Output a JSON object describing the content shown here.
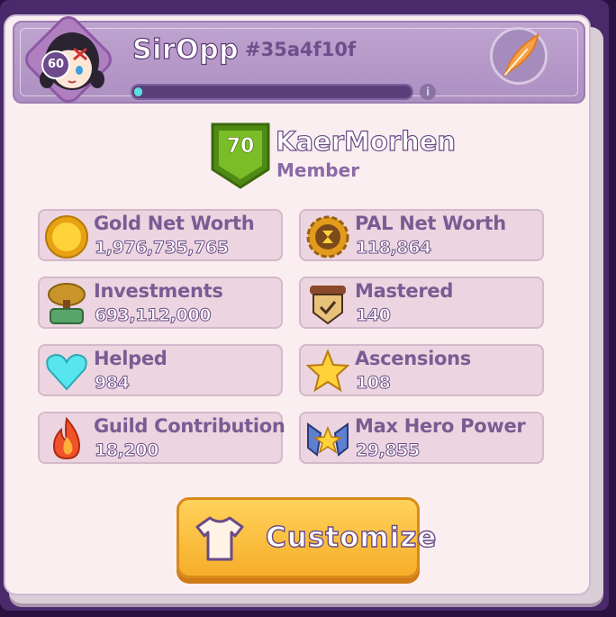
{
  "player": {
    "level": "60",
    "name": "SirOpp",
    "id": "#35a4f10f",
    "xp_progress": 0.03
  },
  "guild": {
    "level": "70",
    "name": "KaerMorhen",
    "role": "Member"
  },
  "stats": [
    {
      "label": "Gold Net Worth",
      "value": "1,976,735,765",
      "icon": "gold-coin-icon"
    },
    {
      "label": "PAL Net Worth",
      "value": "118,864",
      "icon": "pal-gear-icon"
    },
    {
      "label": "Investments",
      "value": "693,112,000",
      "icon": "investment-tree-icon"
    },
    {
      "label": "Mastered",
      "value": "140",
      "icon": "mastered-scroll-icon"
    },
    {
      "label": "Helped",
      "value": "984",
      "icon": "heart-icon"
    },
    {
      "label": "Ascensions",
      "value": "108",
      "icon": "star-icon"
    },
    {
      "label": "Guild Contribution",
      "value": "18,200",
      "icon": "flame-icon"
    },
    {
      "label": "Max Hero Power",
      "value": "29,855",
      "icon": "hero-power-icon"
    }
  ],
  "customize_label": "Customize",
  "colors": {
    "header": "#b59ac8",
    "panel": "#fbeef0",
    "card": "#ecd5e0",
    "xp_fill": "#5ee0e3",
    "button": "#f8b630",
    "guild_shield": "#6fa81f"
  }
}
